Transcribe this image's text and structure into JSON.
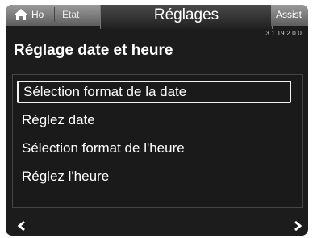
{
  "tabs": {
    "home_label": "Ho",
    "etat_label": "Etat",
    "active_label": "Réglages",
    "assist_label": "Assist"
  },
  "version": "3.1.19.2.0.0",
  "page_title": "Réglage date et heure",
  "menu": {
    "items": [
      {
        "label": "Sélection format de la date",
        "selected": true
      },
      {
        "label": "Réglez date",
        "selected": false
      },
      {
        "label": "Sélection format de l'heure",
        "selected": false
      },
      {
        "label": "Réglez l'heure",
        "selected": false
      }
    ]
  },
  "icons": {
    "home": "home-icon",
    "prev": "chevron-left-icon",
    "next": "chevron-right-icon"
  },
  "colors": {
    "background": "#1c1c1c",
    "text": "#ffffff",
    "selection_border": "#f2f2f2"
  }
}
